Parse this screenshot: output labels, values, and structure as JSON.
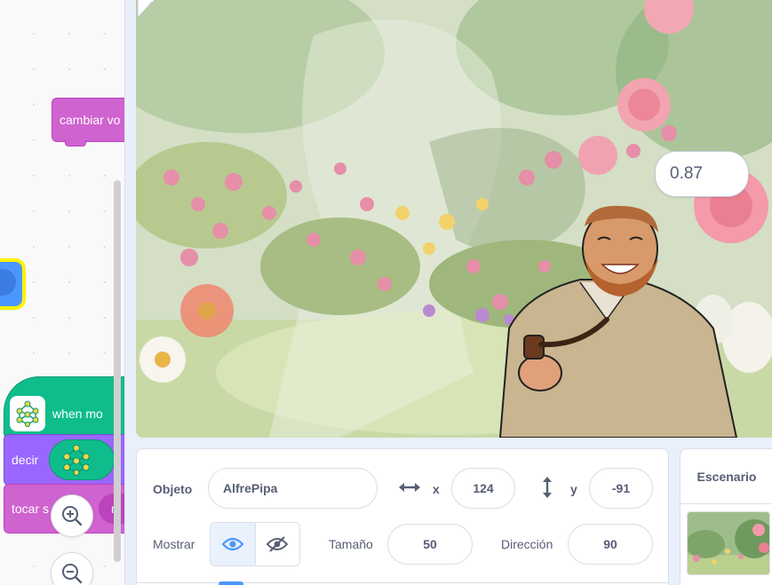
{
  "code_area": {
    "blocks": {
      "cambiar_label": "cambiar vo",
      "when_label": "when mo",
      "decir_label": "decir",
      "tocar_label": "tocar s",
      "tocar_oval_label": "m"
    },
    "colors": {
      "looks": "#9966ff",
      "sound": "#cf63cf",
      "ml_extension": "#0fbd8c",
      "selected_highlight": "#fff200"
    }
  },
  "zoom": {
    "zoom_in_icon": "zoom-in-icon",
    "zoom_out_icon": "zoom-out-icon"
  },
  "stage": {
    "speech_bubble": "0.87",
    "sprite_name": "AlfrePipa"
  },
  "sprite_info": {
    "object_label": "Objeto",
    "name": "AlfrePipa",
    "x_label": "x",
    "x": "124",
    "y_label": "y",
    "y": "-91",
    "show_label": "Mostrar",
    "size_label": "Tamaño",
    "size": "50",
    "direction_label": "Dirección",
    "direction": "90",
    "visible": true
  },
  "stage_selector": {
    "title": "Escenario"
  },
  "accent_color": "#4c97ff"
}
